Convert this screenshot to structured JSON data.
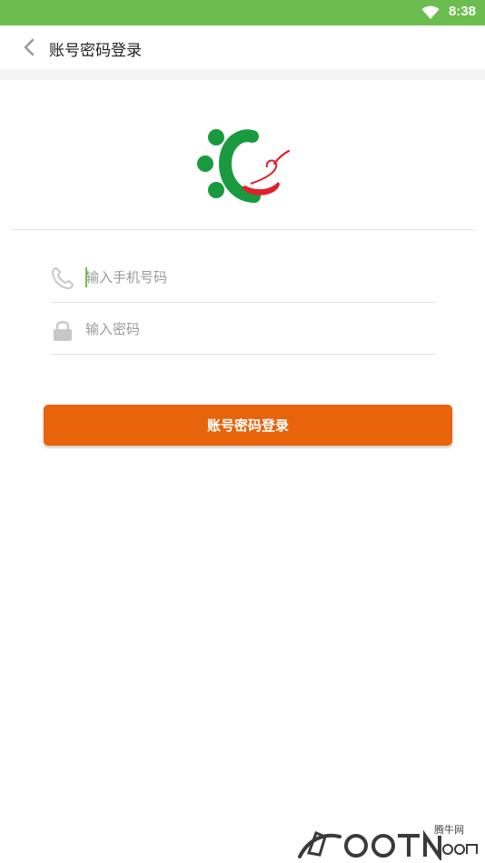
{
  "status_bar": {
    "time": "8:38",
    "wifi_icon": "wifi-icon",
    "background": "#6cbd4f"
  },
  "toolbar": {
    "title": "账号密码登录",
    "back_icon": "chevron-left-icon"
  },
  "logo": {
    "icon": "app-logo",
    "colors": {
      "green": "#1a9a3e",
      "red": "#e0202a"
    }
  },
  "form": {
    "phone": {
      "placeholder": "输入手机号码",
      "value": "",
      "icon": "phone-icon"
    },
    "password": {
      "placeholder": "输入密码",
      "value": "",
      "icon": "lock-icon"
    }
  },
  "login_button": {
    "label": "账号密码登录",
    "color": "#e8630a"
  },
  "watermark": {
    "text": "腾牛网",
    "icon": "qqtn-watermark-logo"
  }
}
